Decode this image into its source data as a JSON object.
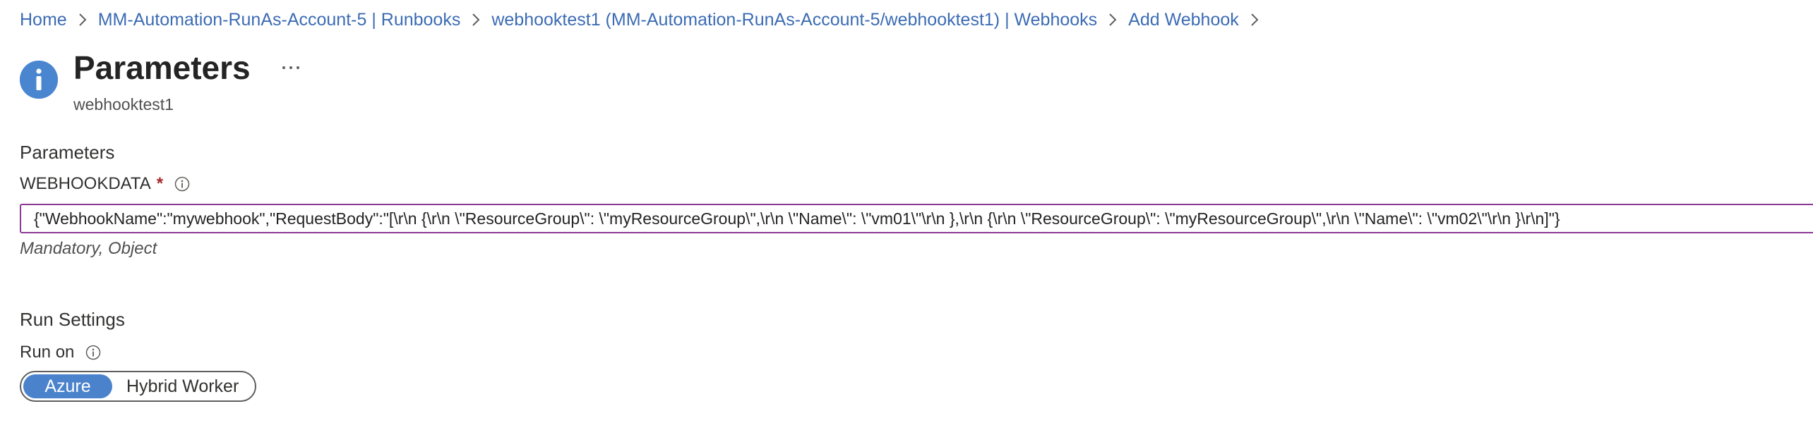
{
  "breadcrumb": {
    "items": [
      "Home",
      "MM-Automation-RunAs-Account-5 | Runbooks",
      "webhooktest1 (MM-Automation-RunAs-Account-5/webhooktest1) | Webhooks",
      "Add Webhook"
    ]
  },
  "header": {
    "title": "Parameters",
    "subtitle": "webhooktest1",
    "more": "···"
  },
  "parameters": {
    "section_title": "Parameters",
    "field_label": "WEBHOOKDATA",
    "required_marker": "*",
    "value": "{\"WebhookName\":\"mywebhook\",\"RequestBody\":\"[\\r\\n {\\r\\n \\\"ResourceGroup\\\": \\\"myResourceGroup\\\",\\r\\n \\\"Name\\\": \\\"vm01\\\"\\r\\n },\\r\\n {\\r\\n \\\"ResourceGroup\\\": \\\"myResourceGroup\\\",\\r\\n \\\"Name\\\": \\\"vm02\\\"\\r\\n }\\r\\n]\"}",
    "hint": "Mandatory, Object"
  },
  "run_settings": {
    "section_title": "Run Settings",
    "run_on_label": "Run on",
    "options": [
      "Azure",
      "Hybrid Worker"
    ],
    "selected": "Azure"
  },
  "colors": {
    "link": "#3c6cb4",
    "accent": "#4a82cc",
    "input_border": "#8a3a93",
    "required": "#a4262c"
  },
  "icons": {
    "header": "info-icon",
    "field_info": "info-outline-icon",
    "breadcrumb_separator": "chevron-right-icon",
    "more": "more-horizontal-icon"
  }
}
